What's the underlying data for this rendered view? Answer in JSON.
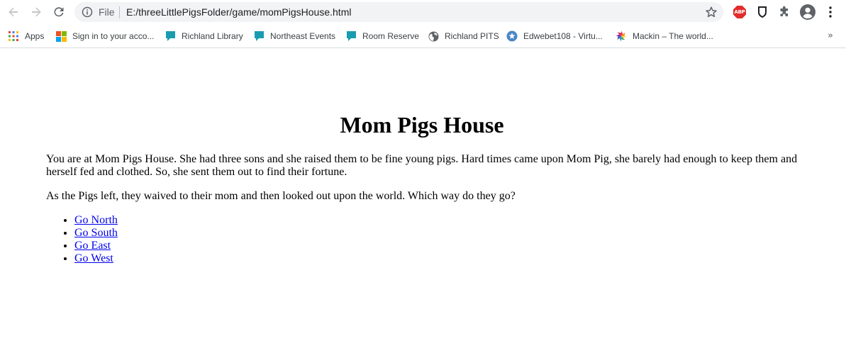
{
  "browser": {
    "omnibox": {
      "scheme_label": "File",
      "url": "E:/threeLittlePigsFolder/game/momPigsHouse.html"
    },
    "extensions": {
      "adblock_label": "ABP"
    },
    "bookmarks": [
      {
        "label": "Apps",
        "icon": "apps-grid-icon"
      },
      {
        "label": "Sign in to your acco...",
        "icon": "microsoft-logo-icon"
      },
      {
        "label": "Richland Library",
        "icon": "speech-bubble-icon"
      },
      {
        "label": "Northeast Events",
        "icon": "speech-bubble-icon"
      },
      {
        "label": "Room Reserve",
        "icon": "speech-bubble-icon"
      },
      {
        "label": "Richland PITS",
        "icon": "globe-icon"
      },
      {
        "label": "Edwebet108 - Virtu...",
        "icon": "star-badge-icon"
      },
      {
        "label": "Mackin – The world...",
        "icon": "pinwheel-icon"
      }
    ],
    "bookmarks_overflow": "»",
    "colors": {
      "link": "#0000ee",
      "bookmark_teal": "#1a9cb0",
      "abp_red": "#e22b2b"
    }
  },
  "page": {
    "title": "Mom Pigs House",
    "paragraph1": "You are at Mom Pigs House. She had three sons and she raised them to be fine young pigs. Hard times came upon Mom Pig, she barely had enough to keep them and herself fed and clothed. So, she sent them out to find their fortune.",
    "paragraph2": "As the Pigs left, they waived to their mom and then looked out upon the world. Which way do they go?",
    "links": [
      {
        "label": "Go North"
      },
      {
        "label": "Go South"
      },
      {
        "label": "Go East"
      },
      {
        "label": "Go West"
      }
    ]
  }
}
